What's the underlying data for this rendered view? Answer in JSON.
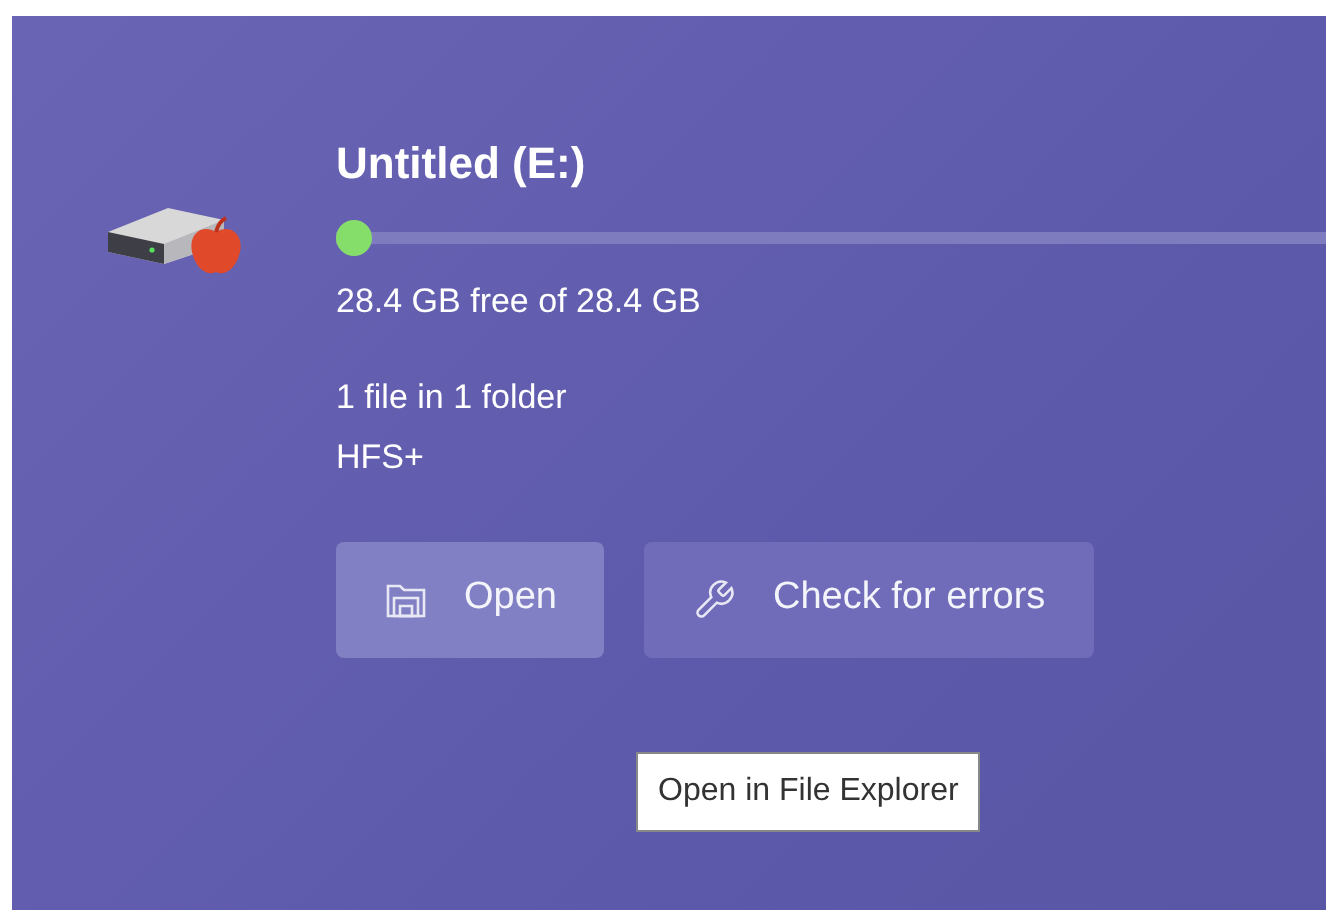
{
  "drive": {
    "title": "Untitled (E:)",
    "usage": {
      "level": 0.01
    },
    "free_text": "28.4 GB free of 28.4 GB",
    "contents": "1 file in 1 folder",
    "file_system": "HFS+"
  },
  "buttons": [
    {
      "label": "Open",
      "kind": "open",
      "hovered": true
    },
    {
      "label": "Check for errors",
      "kind": "check",
      "hovered": false
    }
  ],
  "tooltip": {
    "text": "Open in File Explorer"
  }
}
